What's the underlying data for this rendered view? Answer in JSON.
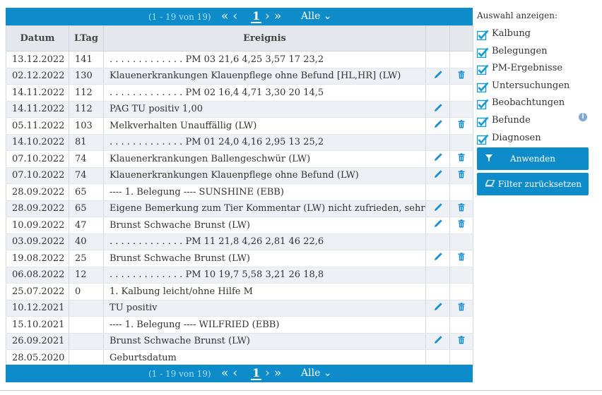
{
  "pager": {
    "info": "(1 - 19 von 19)",
    "first": "«",
    "prev": "‹",
    "page": "1",
    "next": "›",
    "last": "»",
    "per_page": "Alle ⌄"
  },
  "table": {
    "columns": [
      "Datum",
      "LTag",
      "Ereignis",
      "",
      ""
    ],
    "rows": [
      {
        "datum": "13.12.2022",
        "ltag": "141",
        "ereignis": ". . . . . . . . . . . . . PM 03 21,6 4,25 3,57   17 23,2",
        "edit": false,
        "del": false
      },
      {
        "datum": "02.12.2022",
        "ltag": "130",
        "ereignis": "Klauenerkrankungen Klauenpflege ohne Befund [HL,HR] (LW)",
        "edit": true,
        "del": true
      },
      {
        "datum": "14.11.2022",
        "ltag": "112",
        "ereignis": ". . . . . . . . . . . . . PM 02 16,4 4,71 3,30   20 14,5",
        "edit": false,
        "del": false
      },
      {
        "datum": "14.11.2022",
        "ltag": "112",
        "ereignis": "PAG TU positiv  1,00",
        "edit": true,
        "del": false
      },
      {
        "datum": "05.11.2022",
        "ltag": "103",
        "ereignis": "Melkverhalten Unauffällig (LW)",
        "edit": true,
        "del": true
      },
      {
        "datum": "14.10.2022",
        "ltag": "81",
        "ereignis": ". . . . . . . . . . . . . PM 01 24,0 4,16 2,95   13 25,2",
        "edit": false,
        "del": false
      },
      {
        "datum": "07.10.2022",
        "ltag": "74",
        "ereignis": "Klauenerkrankungen Ballengeschwür (LW)",
        "edit": true,
        "del": true
      },
      {
        "datum": "07.10.2022",
        "ltag": "74",
        "ereignis": "Klauenerkrankungen Klauenpflege ohne Befund (LW)",
        "edit": true,
        "del": true
      },
      {
        "datum": "28.09.2022",
        "ltag": "65",
        "ereignis": "---- 1. Belegung ---- SUNSHINE  (EBB)",
        "edit": false,
        "del": false
      },
      {
        "datum": "28.09.2022",
        "ltag": "65",
        "ereignis": "Eigene Bemerkung zum Tier Kommentar (LW) nicht zufrieden, sehr eng",
        "edit": true,
        "del": true
      },
      {
        "datum": "10.09.2022",
        "ltag": "47",
        "ereignis": "Brunst Schwache Brunst (LW)",
        "edit": true,
        "del": true
      },
      {
        "datum": "03.09.2022",
        "ltag": "40",
        "ereignis": ". . . . . . . . . . . . . PM 11 21,8 4,26 2,81   46 22,6",
        "edit": false,
        "del": false
      },
      {
        "datum": "19.08.2022",
        "ltag": "25",
        "ereignis": "Brunst Schwache Brunst (LW)",
        "edit": true,
        "del": true
      },
      {
        "datum": "06.08.2022",
        "ltag": "12",
        "ereignis": ". . . . . . . . . . . . . PM 10 19,7 5,58 3,21   26 18,8",
        "edit": false,
        "del": false
      },
      {
        "datum": "25.07.2022",
        "ltag": "0",
        "ereignis": "1. Kalbung leicht/ohne Hilfe  M",
        "edit": false,
        "del": false
      },
      {
        "datum": "10.12.2021",
        "ltag": "",
        "ereignis": "TU positiv",
        "edit": true,
        "del": true
      },
      {
        "datum": "15.10.2021",
        "ltag": "",
        "ereignis": "---- 1. Belegung ---- WILFRIED  (EBB)",
        "edit": false,
        "del": false
      },
      {
        "datum": "26.09.2021",
        "ltag": "",
        "ereignis": "Brunst Schwache Brunst (LW)",
        "edit": true,
        "del": true
      },
      {
        "datum": "28.05.2020",
        "ltag": "",
        "ereignis": "Geburtsdatum",
        "edit": false,
        "del": false
      }
    ]
  },
  "sidebar": {
    "title": "Auswahl anzeigen:",
    "filters": [
      {
        "label": "Kalbung",
        "checked": true
      },
      {
        "label": "Belegungen",
        "checked": true
      },
      {
        "label": "PM-Ergebnisse",
        "checked": true
      },
      {
        "label": "Untersuchungen",
        "checked": true
      },
      {
        "label": "Beobachtungen",
        "checked": true
      },
      {
        "label": "Befunde",
        "checked": true
      },
      {
        "label": "Diagnosen",
        "checked": true
      }
    ],
    "info_icon": "info-icon",
    "apply_label": "Anwenden",
    "reset_label": "Filter zurücksetzen"
  },
  "colors": {
    "accent": "#0e8cc9",
    "header_bg": "#e4e7ec",
    "row_alt": "#edf0f4",
    "check": "#1a9bd1",
    "info": "#7fa9d4"
  }
}
